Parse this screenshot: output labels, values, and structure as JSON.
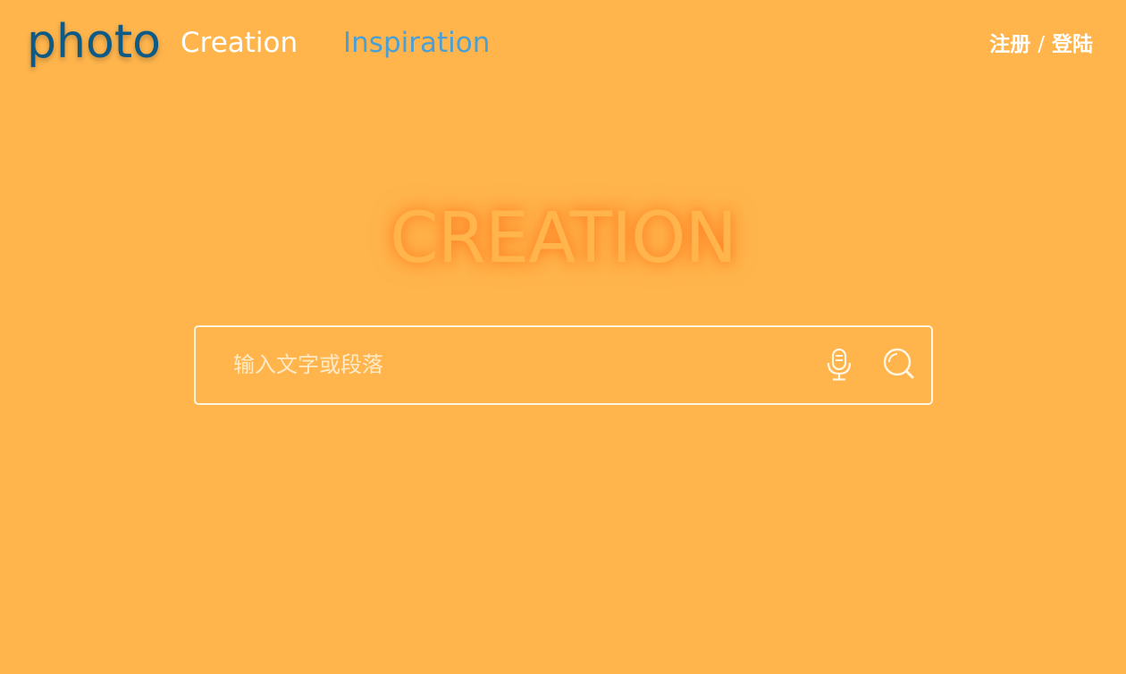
{
  "header": {
    "logo": "photo",
    "nav": {
      "creation": "Creation",
      "inspiration": "Inspiration"
    },
    "auth": {
      "register": "注册",
      "separator": "/",
      "login": "登陆"
    }
  },
  "hero": {
    "title": "CREATION"
  },
  "search": {
    "placeholder": "输入文字或段落",
    "value": "",
    "mic_icon": "microphone-icon",
    "search_icon": "search-icon"
  },
  "colors": {
    "background": "#FFB54C",
    "logo": "#0E5A86",
    "nav_active": "#FFFFFF",
    "nav_link": "#4A9FD4",
    "title_glow": "#FF6E14"
  }
}
